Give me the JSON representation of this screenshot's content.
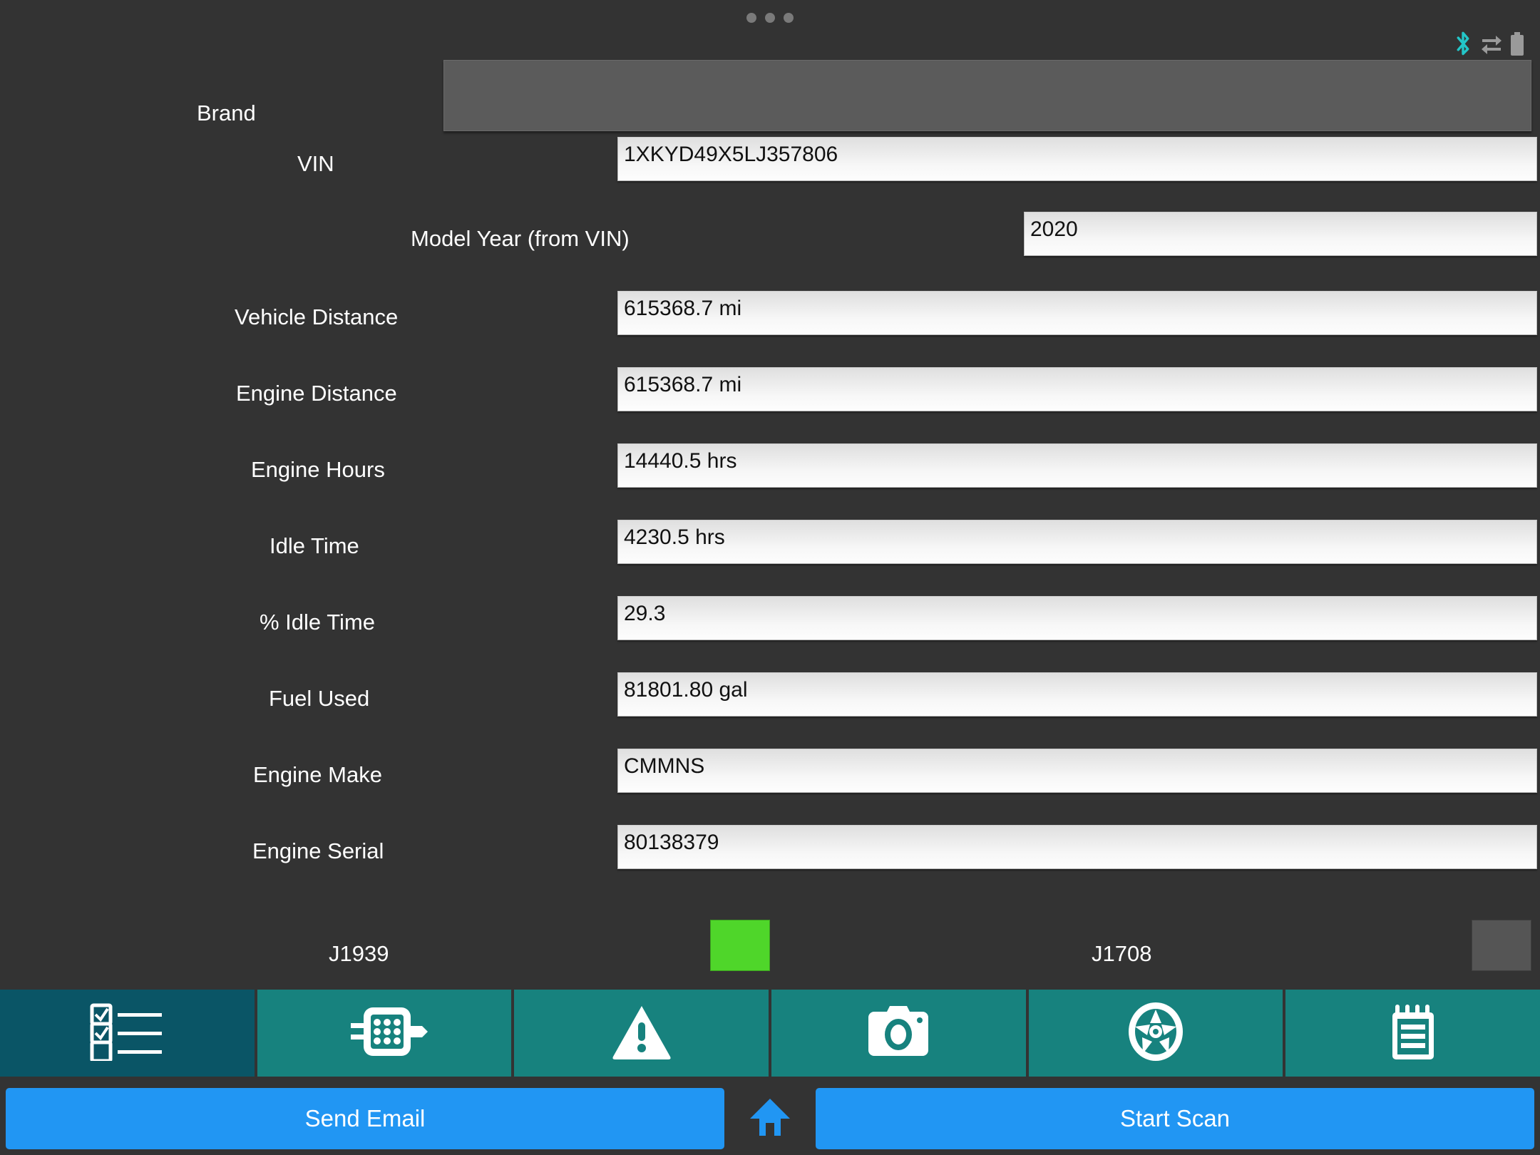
{
  "statusbar": {
    "dots_count": 3,
    "icons": [
      {
        "name": "bluetooth-icon",
        "color": "#23c6c8"
      },
      {
        "name": "data-transfer-icon",
        "color": "#9a9a9a"
      },
      {
        "name": "battery-icon",
        "color": "#9a9a9a"
      }
    ]
  },
  "form": {
    "brand": {
      "label": "Brand",
      "value": "",
      "type": "spinner"
    },
    "fields": [
      {
        "label": "VIN",
        "value": "1XKYD49X5LJ357806"
      },
      {
        "label": "Model Year (from VIN)",
        "value": "2020"
      },
      {
        "label": "Vehicle Distance",
        "value": "615368.7 mi"
      },
      {
        "label": "Engine Distance",
        "value": "615368.7 mi"
      },
      {
        "label": "Engine Hours",
        "value": "14440.5 hrs"
      },
      {
        "label": "Idle Time",
        "value": "4230.5 hrs"
      },
      {
        "label": "% Idle Time",
        "value": "29.3"
      },
      {
        "label": "Fuel Used",
        "value": "81801.80 gal"
      },
      {
        "label": "Engine Make",
        "value": "CMMNS"
      },
      {
        "label": "Engine Serial",
        "value": "80138379"
      }
    ]
  },
  "protocols": [
    {
      "label": "J1939",
      "state": "active",
      "color": "#4fd62a"
    },
    {
      "label": "J1708",
      "state": "inactive",
      "color": "#555555"
    }
  ],
  "tabs": [
    {
      "icon": "checklist-icon",
      "name": "tab-checklist",
      "selected": true
    },
    {
      "icon": "connector-icon",
      "name": "tab-connector",
      "selected": false
    },
    {
      "icon": "warning-icon",
      "name": "tab-faults",
      "selected": false
    },
    {
      "icon": "camera-icon",
      "name": "tab-camera",
      "selected": false
    },
    {
      "icon": "wheel-icon",
      "name": "tab-tires",
      "selected": false
    },
    {
      "icon": "notepad-icon",
      "name": "tab-notes",
      "selected": false
    }
  ],
  "buttons": {
    "send_email": "Send Email",
    "home": "",
    "start_scan": "Start Scan"
  },
  "colors": {
    "background": "#333333",
    "tab": "#17827e",
    "tab_selected": "#0a5566",
    "primary_button": "#2196f3",
    "led_on": "#4fd62a",
    "led_off": "#555555",
    "bluetooth": "#23c6c8"
  }
}
